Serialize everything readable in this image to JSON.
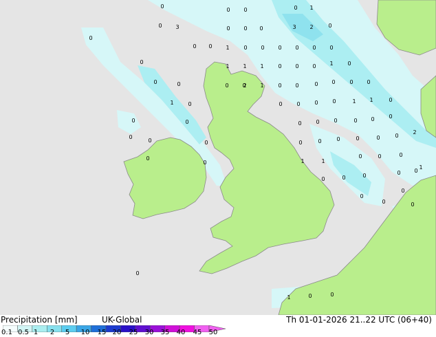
{
  "legend": {
    "title": "Precipitation [mm]",
    "model": "UK-Global",
    "valid_time": "Th 01-01-2026 21..22 UTC (06+40)",
    "ticks": [
      "0.1",
      "0.5",
      "1",
      "2",
      "5",
      "10",
      "15",
      "20",
      "25",
      "30",
      "35",
      "40",
      "45",
      "50"
    ],
    "colors": [
      "#f5fdfd",
      "#d2f5f5",
      "#aaeef0",
      "#87e0ee",
      "#5ccdf0",
      "#3aa6e6",
      "#1f6fd8",
      "#1c3bcf",
      "#2a10c8",
      "#6010d0",
      "#9a10d8",
      "#d010d8",
      "#f010e0",
      "#f060f0"
    ]
  },
  "map": {
    "sea_color": "#e5e5e5",
    "land_color": "#b9ee8c",
    "rain_light_color": "#d6f7f8",
    "rain_medium_color": "#aceef2",
    "rain_heavy_color": "#8fe2ee",
    "labels": [
      {
        "t": "0"
      },
      {
        "t": "0"
      },
      {
        "t": "0"
      },
      {
        "t": "0"
      },
      {
        "t": "1"
      },
      {
        "t": "0"
      },
      {
        "t": "3"
      },
      {
        "t": "0"
      },
      {
        "t": "0"
      },
      {
        "t": "3"
      },
      {
        "t": "2"
      },
      {
        "t": "0"
      },
      {
        "t": "0"
      },
      {
        "t": "0"
      },
      {
        "t": "1"
      },
      {
        "t": "0"
      },
      {
        "t": "0"
      },
      {
        "t": "0"
      },
      {
        "t": "0"
      },
      {
        "t": "0"
      },
      {
        "t": "0"
      },
      {
        "t": "0"
      },
      {
        "t": "0"
      },
      {
        "t": "0"
      },
      {
        "t": "1"
      },
      {
        "t": "1"
      },
      {
        "t": "1"
      },
      {
        "t": "0"
      },
      {
        "t": "0"
      },
      {
        "t": "0"
      },
      {
        "t": "1"
      },
      {
        "t": "0"
      },
      {
        "t": "0"
      },
      {
        "t": "0"
      },
      {
        "t": "0"
      },
      {
        "t": "0"
      },
      {
        "t": "1"
      },
      {
        "t": "0"
      },
      {
        "t": "0"
      },
      {
        "t": "2"
      },
      {
        "t": "0"
      },
      {
        "t": "0"
      },
      {
        "t": "0"
      },
      {
        "t": "0"
      },
      {
        "t": "1"
      },
      {
        "t": "0"
      },
      {
        "t": "0"
      },
      {
        "t": "0"
      },
      {
        "t": "0"
      },
      {
        "t": "0"
      },
      {
        "t": "1"
      },
      {
        "t": "0"
      },
      {
        "t": "1"
      },
      {
        "t": "0"
      },
      {
        "t": "0"
      },
      {
        "t": "0"
      },
      {
        "t": "0"
      },
      {
        "t": "0"
      },
      {
        "t": "0"
      },
      {
        "t": "0"
      },
      {
        "t": "0"
      },
      {
        "t": "2"
      },
      {
        "t": "0"
      },
      {
        "t": "0"
      },
      {
        "t": "0"
      },
      {
        "t": "0"
      },
      {
        "t": "0"
      },
      {
        "t": "1"
      },
      {
        "t": "0"
      },
      {
        "t": "0"
      },
      {
        "t": "0"
      },
      {
        "t": "0"
      },
      {
        "t": "0"
      },
      {
        "t": "0"
      },
      {
        "t": "1"
      },
      {
        "t": "0"
      },
      {
        "t": "0"
      },
      {
        "t": "0"
      },
      {
        "t": "1"
      },
      {
        "t": "0"
      },
      {
        "t": "0"
      },
      {
        "t": "0"
      },
      {
        "t": "0"
      },
      {
        "t": "0"
      },
      {
        "t": "0"
      },
      {
        "t": "0"
      },
      {
        "t": "0"
      },
      {
        "t": "0"
      },
      {
        "t": "0"
      },
      {
        "t": "1"
      },
      {
        "t": "0"
      },
      {
        "t": "0"
      }
    ]
  }
}
